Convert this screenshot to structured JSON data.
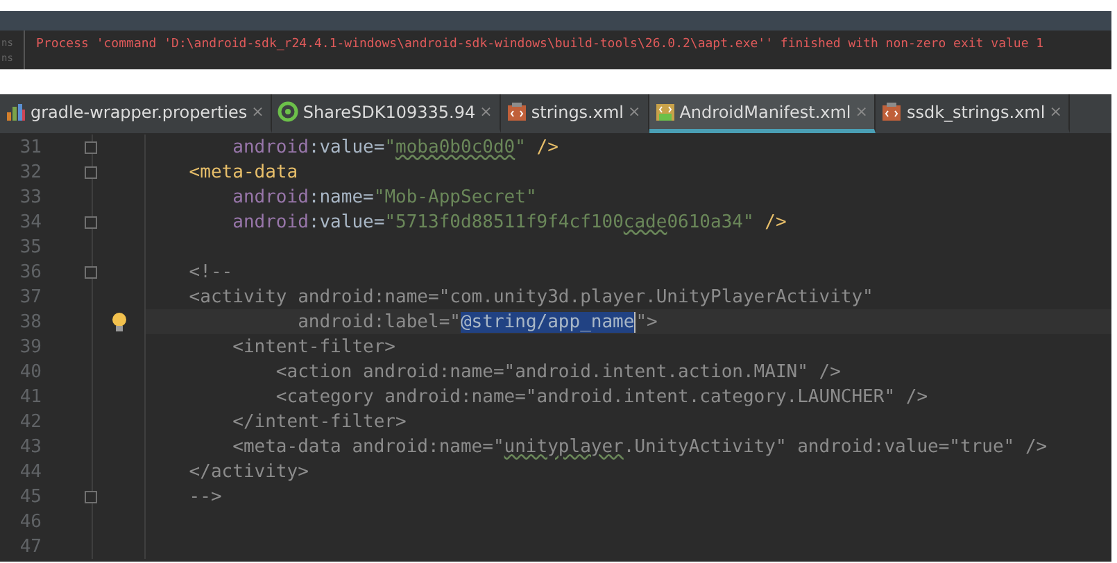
{
  "console": {
    "gutter": [
      "ns",
      "ns"
    ],
    "message": "Process 'command 'D:\\android-sdk_r24.4.1-windows\\android-sdk-windows\\build-tools\\26.0.2\\aapt.exe'' finished with non-zero exit value 1"
  },
  "tabs": [
    {
      "label": "gradle-wrapper.properties",
      "close": "×",
      "selected": false
    },
    {
      "label": "ShareSDK109335.94",
      "close": "×",
      "selected": false
    },
    {
      "label": "strings.xml",
      "close": "×",
      "selected": false
    },
    {
      "label": "AndroidManifest.xml",
      "close": "×",
      "selected": true
    },
    {
      "label": "ssdk_strings.xml",
      "close": "×",
      "selected": false
    }
  ],
  "editor": {
    "lines": [
      {
        "number": "31",
        "fold": true,
        "bulb": false,
        "tokens": [
          {
            "kind": "ns",
            "text": "        android"
          },
          {
            "kind": "plain",
            "text": ":value="
          },
          {
            "kind": "value",
            "text": "\""
          },
          {
            "kind": "typo",
            "text": "moba0b0c0d0"
          },
          {
            "kind": "value",
            "text": "\""
          },
          {
            "kind": "tag",
            "text": " />"
          }
        ]
      },
      {
        "number": "32",
        "fold": true,
        "bulb": false,
        "tokens": [
          {
            "kind": "tag",
            "text": "    <meta-data"
          }
        ]
      },
      {
        "number": "33",
        "fold": false,
        "bulb": false,
        "tokens": [
          {
            "kind": "ns",
            "text": "        android"
          },
          {
            "kind": "plain",
            "text": ":name="
          },
          {
            "kind": "value",
            "text": "\"Mob-AppSecret\""
          }
        ]
      },
      {
        "number": "34",
        "fold": true,
        "bulb": false,
        "tokens": [
          {
            "kind": "ns",
            "text": "        android"
          },
          {
            "kind": "plain",
            "text": ":value="
          },
          {
            "kind": "value",
            "text": "\"5713f0d88511f9f4cf100"
          },
          {
            "kind": "typo",
            "text": "cade"
          },
          {
            "kind": "value",
            "text": "0610a34\""
          },
          {
            "kind": "tag",
            "text": " />"
          }
        ]
      },
      {
        "number": "35",
        "fold": false,
        "bulb": false
      },
      {
        "number": "36",
        "fold": true,
        "bulb": false,
        "tokens": [
          {
            "kind": "comment",
            "text": "    <!--"
          }
        ]
      },
      {
        "number": "37",
        "fold": false,
        "bulb": false,
        "tokens": [
          {
            "kind": "comment",
            "text": "    <activity android:name=\"com.unity3d.player.UnityPlayerActivity\""
          }
        ]
      },
      {
        "number": "38",
        "fold": false,
        "bulb": true,
        "tokens": [
          {
            "kind": "comment",
            "text": "              android:label=\""
          },
          {
            "kind": "selection",
            "text": "@string/app_name"
          },
          {
            "kind": "comment",
            "text": "\">"
          }
        ]
      },
      {
        "number": "39",
        "fold": false,
        "bulb": false,
        "tokens": [
          {
            "kind": "comment",
            "text": "        <intent-filter>"
          }
        ]
      },
      {
        "number": "40",
        "fold": false,
        "bulb": false,
        "tokens": [
          {
            "kind": "comment",
            "text": "            <action android:name=\"android.intent.action.MAIN\" />"
          }
        ]
      },
      {
        "number": "41",
        "fold": false,
        "bulb": false,
        "tokens": [
          {
            "kind": "comment",
            "text": "            <category android:name=\"android.intent.category.LAUNCHER\" />"
          }
        ]
      },
      {
        "number": "42",
        "fold": false,
        "bulb": false,
        "tokens": [
          {
            "kind": "comment",
            "text": "        </intent-filter>"
          }
        ]
      },
      {
        "number": "43",
        "fold": false,
        "bulb": false,
        "tokens": [
          {
            "kind": "comment",
            "text": "        <meta-data android:name=\""
          },
          {
            "kind": "commenttypo",
            "text": "unityplayer"
          },
          {
            "kind": "comment",
            "text": ".UnityActivity\" android:value=\"true\" />"
          }
        ]
      },
      {
        "number": "44",
        "fold": false,
        "bulb": false,
        "tokens": [
          {
            "kind": "comment",
            "text": "    </activity>"
          }
        ]
      },
      {
        "number": "45",
        "fold": true,
        "bulb": false,
        "tokens": [
          {
            "kind": "comment",
            "text": "    -->"
          }
        ]
      },
      {
        "number": "46",
        "fold": false,
        "bulb": false
      },
      {
        "number": "47",
        "fold": false,
        "bulb": false
      }
    ]
  }
}
